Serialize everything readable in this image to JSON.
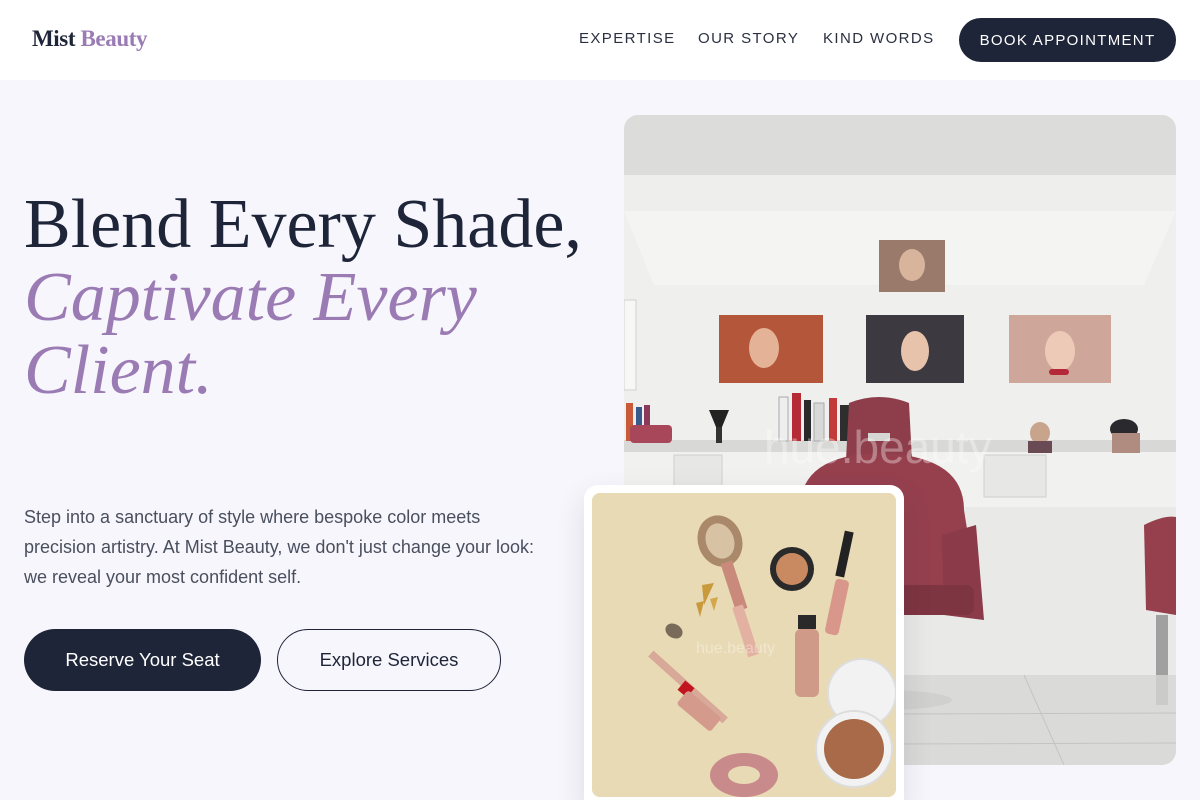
{
  "brand": {
    "name_part1": "Mist",
    "name_part2": "Beauty"
  },
  "nav": {
    "items": [
      {
        "label": "EXPERTISE"
      },
      {
        "label": "OUR STORY"
      },
      {
        "label": "KIND WORDS"
      }
    ],
    "cta_label": "BOOK APPOINTMENT"
  },
  "hero": {
    "title_line1": "Blend Every Shade,",
    "title_line2": "Captivate Every Client.",
    "description": "Step into a sanctuary of style where bespoke color meets precision artistry. At Mist Beauty, we don't just change your look: we reveal your most confident self.",
    "primary_cta": "Reserve Your Seat",
    "secondary_cta": "Explore Services"
  },
  "colors": {
    "navy": "#1e2538",
    "lavender": "#9b7bb4",
    "background": "#f7f6fc",
    "header_bg": "#ffffff"
  }
}
